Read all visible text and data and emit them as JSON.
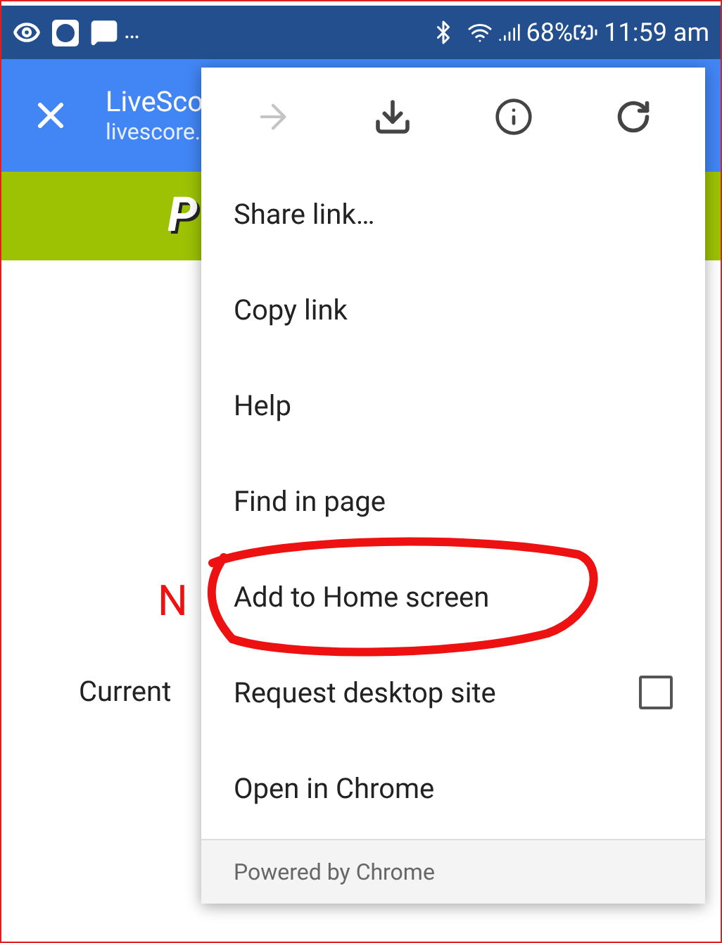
{
  "status_bar": {
    "more": "…",
    "battery": "68%",
    "time": "11:59 am"
  },
  "toolbar": {
    "title": "LiveSco",
    "url": "livescore."
  },
  "banner": {
    "logo": "P"
  },
  "page": {
    "heading": "N",
    "line": "Current"
  },
  "menu": {
    "icons": [
      {
        "kind": "forward",
        "disabled": true
      },
      {
        "kind": "download",
        "disabled": false
      },
      {
        "kind": "info",
        "disabled": false
      },
      {
        "kind": "reload",
        "disabled": false
      }
    ],
    "items": [
      {
        "kind": "plain",
        "label": "Share link…",
        "highlighted": false
      },
      {
        "kind": "plain",
        "label": "Copy link",
        "highlighted": false
      },
      {
        "kind": "plain",
        "label": "Help",
        "highlighted": false
      },
      {
        "kind": "plain",
        "label": "Find in page",
        "highlighted": false
      },
      {
        "kind": "plain",
        "label": "Add to Home screen",
        "highlighted": true
      },
      {
        "kind": "checkbox",
        "label": "Request desktop site",
        "checked": false,
        "highlighted": false
      },
      {
        "kind": "plain",
        "label": "Open in Chrome",
        "highlighted": false
      }
    ],
    "footer": "Powered by Chrome"
  }
}
